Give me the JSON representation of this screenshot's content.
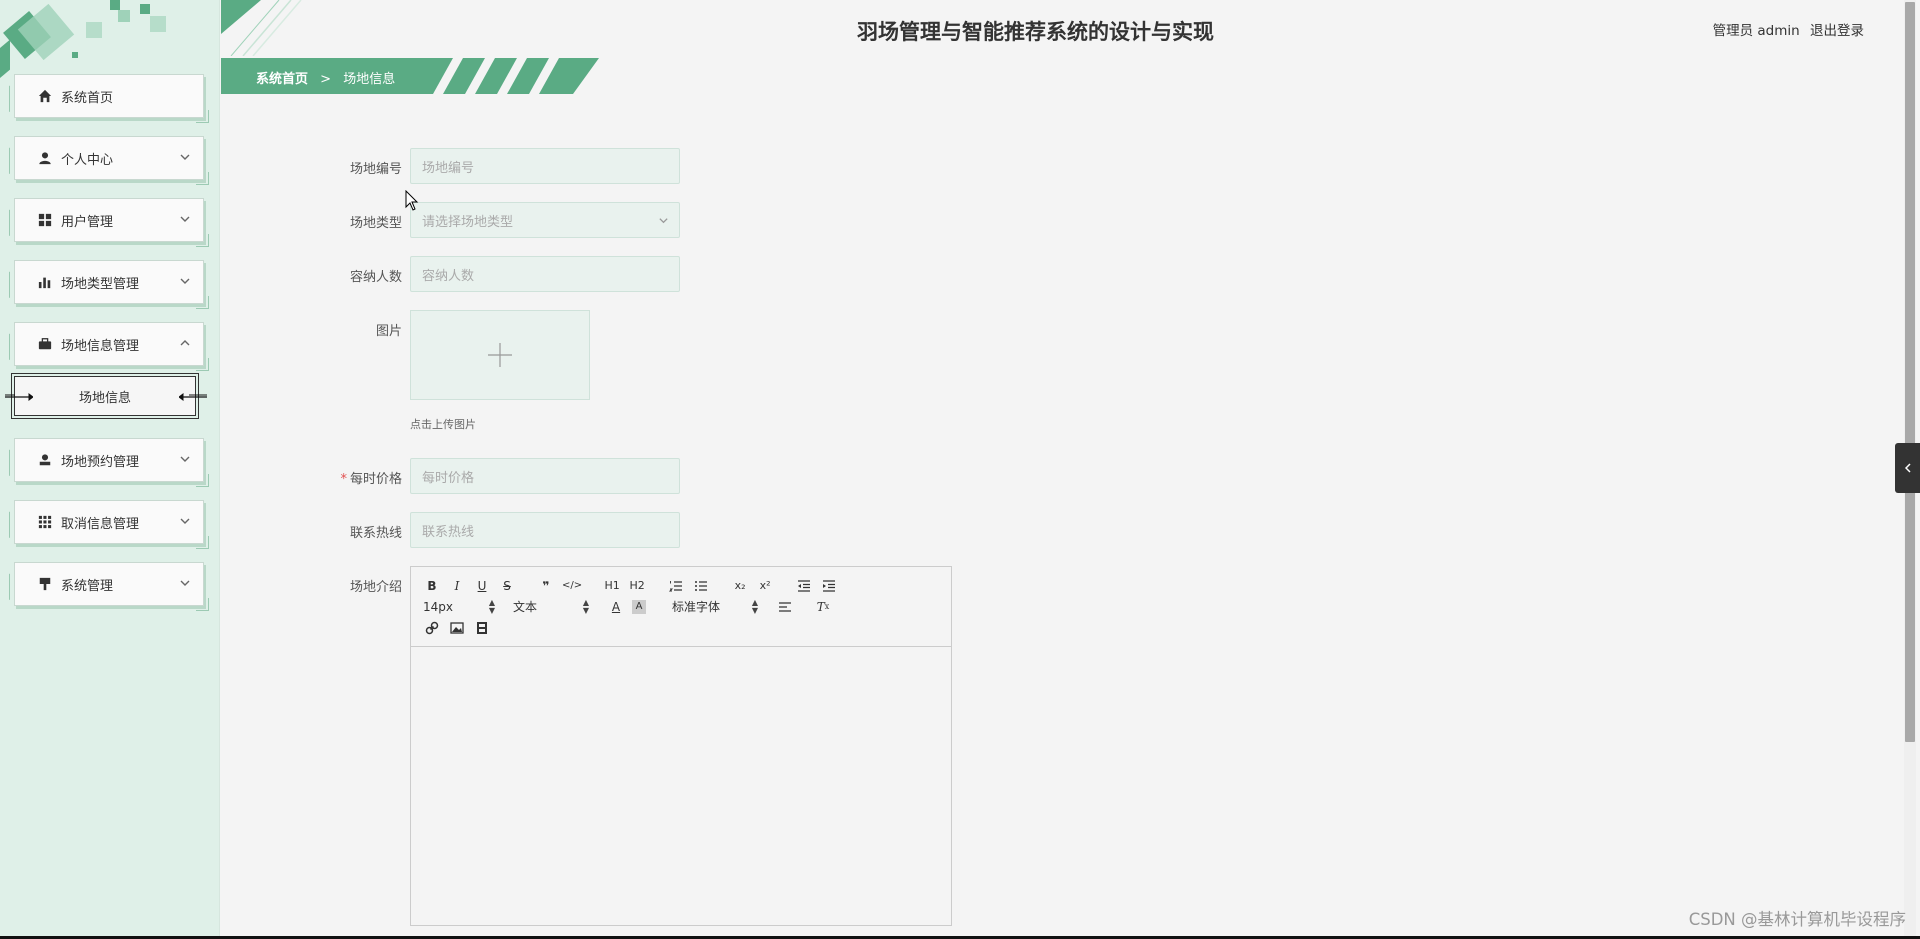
{
  "header": {
    "title": "羽场管理与智能推荐系统的设计与实现",
    "user_role": "管理员 admin",
    "logout_label": "退出登录"
  },
  "breadcrumb": {
    "home": "系统首页",
    "separator": ">",
    "current": "场地信息"
  },
  "sidebar": {
    "items": [
      {
        "label": "系统首页",
        "icon": "home-icon",
        "expandable": false
      },
      {
        "label": "个人中心",
        "icon": "user-icon",
        "expandable": true
      },
      {
        "label": "用户管理",
        "icon": "grid-icon",
        "expandable": true
      },
      {
        "label": "场地类型管理",
        "icon": "bar-chart-icon",
        "expandable": true
      },
      {
        "label": "场地信息管理",
        "icon": "briefcase-icon",
        "expandable": true,
        "expanded": true
      },
      {
        "label": "场地预约管理",
        "icon": "user-stamp-icon",
        "expandable": true
      },
      {
        "label": "取消信息管理",
        "icon": "apps-icon",
        "expandable": true
      },
      {
        "label": "系统管理",
        "icon": "pin-icon",
        "expandable": true
      }
    ],
    "active_subitem": "场地信息"
  },
  "form": {
    "venue_no": {
      "label": "场地编号",
      "placeholder": "场地编号"
    },
    "venue_type": {
      "label": "场地类型",
      "placeholder": "请选择场地类型"
    },
    "capacity": {
      "label": "容纳人数",
      "placeholder": "容纳人数"
    },
    "image": {
      "label": "图片",
      "tip": "点击上传图片"
    },
    "price": {
      "label": "每时价格",
      "placeholder": "每时价格",
      "required_mark": "*"
    },
    "hotline": {
      "label": "联系热线",
      "placeholder": "联系热线"
    },
    "intro": {
      "label": "场地介绍"
    }
  },
  "editor": {
    "font_size": "14px",
    "text_style": "文本",
    "font_family": "标准字体",
    "buttons": [
      "B",
      "I",
      "U",
      "S",
      "❞",
      "</>",
      "H1",
      "H2",
      "ordered-list",
      "bullet-list",
      "x₂",
      "x²",
      "outdent",
      "indent"
    ]
  },
  "watermark": "CSDN @基林计算机毕设程序",
  "colors": {
    "accent": "#5aab84",
    "sidebar_bg": "#dff0e8",
    "input_bg": "#e9f2ee"
  }
}
